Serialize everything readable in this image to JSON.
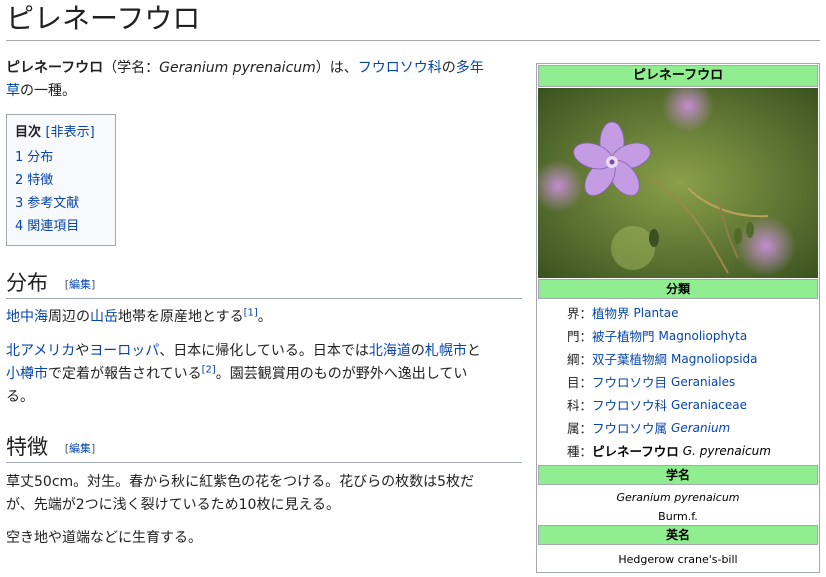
{
  "page": {
    "title": "ピレネーフウロ"
  },
  "intro": {
    "bold_name": "ピレネーフウロ",
    "paren_prefix": "（学名：",
    "scientific": "Geranium pyrenaicum",
    "paren_suffix": "）は、",
    "family_link": "フウロソウ科",
    "word_no": "の",
    "perennial_link": "多年",
    "line2_link": "草",
    "line2_rest": "の一種。"
  },
  "toc": {
    "title": "目次",
    "toggle": "[非表示]",
    "items": [
      {
        "num": "1",
        "label": "分布"
      },
      {
        "num": "2",
        "label": "特徴"
      },
      {
        "num": "3",
        "label": "参考文献"
      },
      {
        "num": "4",
        "label": "関連項目"
      }
    ]
  },
  "sections": {
    "edit_open": "[",
    "edit_label": "編集",
    "edit_close": "]",
    "distribution": {
      "heading": "分布",
      "p1_link1": "地中海",
      "p1_text1": "周辺の",
      "p1_link2": "山岳",
      "p1_text2": "地帯を原産地とする",
      "p1_ref": "[1]",
      "p1_end": "。",
      "p2_link1": "北アメリカ",
      "p2_text1": "や",
      "p2_link2": "ヨーロッパ",
      "p2_text2": "、日本に帰化している。日本では",
      "p2_link3": "北海道",
      "p2_text3": "の",
      "p2_link4": "札幌市",
      "p2_text4": "と",
      "p2_link5": "小樽市",
      "p2_text5": "で定着が報告されている",
      "p2_ref": "[2]",
      "p2_text6": "。園芸観賞用のものが野外へ逸出してい",
      "p2_line3": "る。"
    },
    "features": {
      "heading": "特徴",
      "p1_line1": "草丈50cm。対生。春から秋に紅紫色の花をつける。花びらの枚数は5枚だ",
      "p1_line2": "が、先端が2つに浅く裂けているため10枚に見える。",
      "p2": "空き地や道端などに生育する。"
    }
  },
  "infobox": {
    "title": "ピレネーフウロ",
    "classification_header": "分類",
    "taxonomy": [
      {
        "rank": "界",
        "ja": "植物界",
        "latin": "Plantae",
        "italic": false
      },
      {
        "rank": "門",
        "ja": "被子植物門",
        "latin": "Magnoliophyta",
        "italic": false
      },
      {
        "rank": "綱",
        "ja": "双子葉植物綱",
        "latin": "Magnoliopsida",
        "italic": false
      },
      {
        "rank": "目",
        "ja": "フウロソウ目",
        "latin": "Geraniales",
        "italic": false
      },
      {
        "rank": "科",
        "ja": "フウロソウ科",
        "latin": "Geraniaceae",
        "italic": false
      },
      {
        "rank": "属",
        "ja": "フウロソウ属",
        "latin": "Geranium",
        "italic": true
      }
    ],
    "species": {
      "rank": "種",
      "ja": "ピレネーフウロ",
      "latin": "G. pyrenaicum"
    },
    "rank_sep": "：",
    "scientific_header": "学名",
    "scientific_name": "Geranium pyrenaicum",
    "author": "Burm.f.",
    "english_header": "英名",
    "english_name": "Hedgerow crane's-bill"
  },
  "colors": {
    "infobox_header": "#90ee90",
    "link": "#0645ad",
    "text": "#202122"
  }
}
